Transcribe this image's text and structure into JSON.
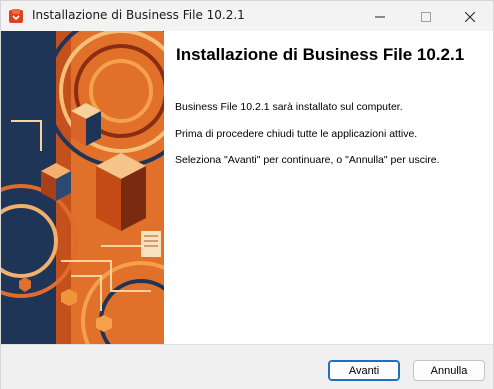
{
  "window": {
    "title": "Installazione di Business File 10.2.1",
    "controls": {
      "minimize_icon": "minimize-icon",
      "maximize_icon": "maximize-icon",
      "close_icon": "close-icon"
    }
  },
  "main": {
    "heading": "Installazione di Business File 10.2.1",
    "paragraphs": [
      "Business File 10.2.1 sarà installato sul computer.",
      "Prima di procedere chiudi tutte le applicazioni attive.",
      "Seleziona \"Avanti\" per continuare, o \"Annulla\" per uscire."
    ]
  },
  "footer": {
    "next_label": "Avanti",
    "cancel_label": "Annulla"
  },
  "colors": {
    "accent": "#1f6ec2",
    "art_orange": "#c4501c",
    "art_navy": "#1e3557"
  }
}
